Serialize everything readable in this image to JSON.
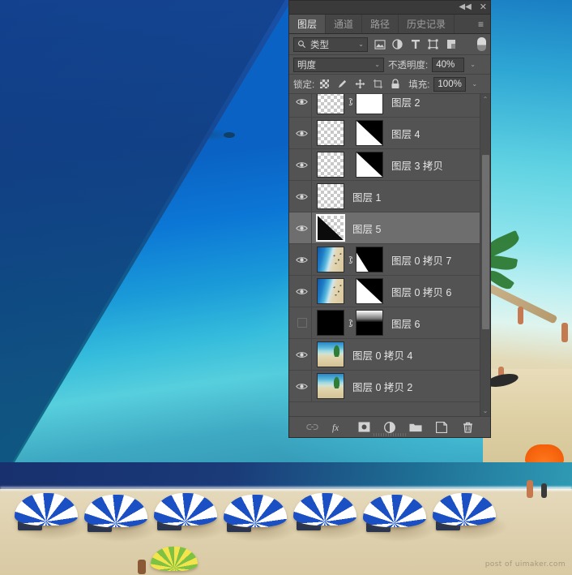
{
  "panel": {
    "titlebar": {
      "collapse": "◀◀",
      "close": "✕"
    },
    "tabs": [
      {
        "label": "图层",
        "active": true
      },
      {
        "label": "通道",
        "active": false
      },
      {
        "label": "路径",
        "active": false
      },
      {
        "label": "历史记录",
        "active": false
      }
    ],
    "menu_glyph": "≡",
    "filter": {
      "search_icon": "search-icon",
      "type_label": "类型",
      "caret": "⌄",
      "icons": [
        "pixel-filter-icon",
        "adjustment-filter-icon",
        "type-filter-icon",
        "shape-filter-icon",
        "smart-object-filter-icon"
      ],
      "toggle_name": "filter-enable-toggle"
    },
    "blend": {
      "mode": "明度",
      "caret": "⌄",
      "opacity_label": "不透明度:",
      "opacity_value": "40%"
    },
    "lock": {
      "label": "锁定:",
      "icons": [
        "lock-transparent-pixels-icon",
        "lock-image-pixels-icon",
        "lock-position-icon",
        "lock-artboard-icon",
        "lock-all-icon"
      ],
      "fill_label": "填充:",
      "fill_value": "100%"
    },
    "layers": [
      {
        "name": "图层 2",
        "visible": true,
        "selected": false,
        "thumb": "checker",
        "linked": true,
        "mask": "white"
      },
      {
        "name": "图层 4",
        "visible": true,
        "selected": false,
        "thumb": "checker",
        "linked": false,
        "mask": "diag-rl"
      },
      {
        "name": "图层 3 拷贝",
        "visible": true,
        "selected": false,
        "thumb": "checker",
        "linked": false,
        "mask": "diag-rl"
      },
      {
        "name": "图层 1",
        "visible": true,
        "selected": false,
        "thumb": "checker",
        "linked": false,
        "mask": "none"
      },
      {
        "name": "图层 5",
        "visible": true,
        "selected": true,
        "thumb": "tri-dark",
        "linked": false,
        "mask": "none"
      },
      {
        "name": "图层 0 拷贝 7",
        "visible": true,
        "selected": false,
        "thumb": "beach",
        "linked": true,
        "mask": "curve"
      },
      {
        "name": "图层 0 拷贝 6",
        "visible": true,
        "selected": false,
        "thumb": "beach",
        "linked": false,
        "mask": "diag-rl"
      },
      {
        "name": "图层 6",
        "visible": false,
        "selected": false,
        "thumb": "black",
        "linked": true,
        "mask": "grad-half"
      },
      {
        "name": "图层 0 拷贝 4",
        "visible": true,
        "selected": false,
        "thumb": "beach-wide",
        "linked": false,
        "mask": "none"
      },
      {
        "name": "图层 0 拷贝 2",
        "visible": true,
        "selected": false,
        "thumb": "beach-wide",
        "linked": false,
        "mask": "none"
      }
    ],
    "scrollbar": {
      "up": "⌃",
      "down": "⌄"
    },
    "footer_icons": [
      {
        "name": "link-layers-button",
        "glyph": "🔗",
        "disabled": true
      },
      {
        "name": "layer-style-fx-button",
        "glyph": "fx",
        "disabled": false
      },
      {
        "name": "add-layer-mask-button",
        "glyph": "◉",
        "disabled": false
      },
      {
        "name": "new-adjustment-layer-button",
        "glyph": "◑",
        "disabled": false
      },
      {
        "name": "new-group-button",
        "glyph": "📁",
        "disabled": false
      },
      {
        "name": "new-layer-button",
        "glyph": "❐",
        "disabled": false
      },
      {
        "name": "delete-layer-button",
        "glyph": "🗑",
        "disabled": false
      }
    ]
  },
  "canvas": {
    "watermark": "post of uimaker.com",
    "description": "Ocean and beach composite with diagonal dark blue overlay"
  },
  "colors": {
    "panel_bg": "#535353",
    "panel_tab_bg": "#454545",
    "panel_title_bg": "#3a3a3a",
    "selected_row": "#6e6e6e",
    "ocean_blue": "#0a63c4",
    "overlay_blue": "#17478f",
    "sand": "#e4d8ba",
    "umbrella_blue": "#1b4fc4"
  }
}
